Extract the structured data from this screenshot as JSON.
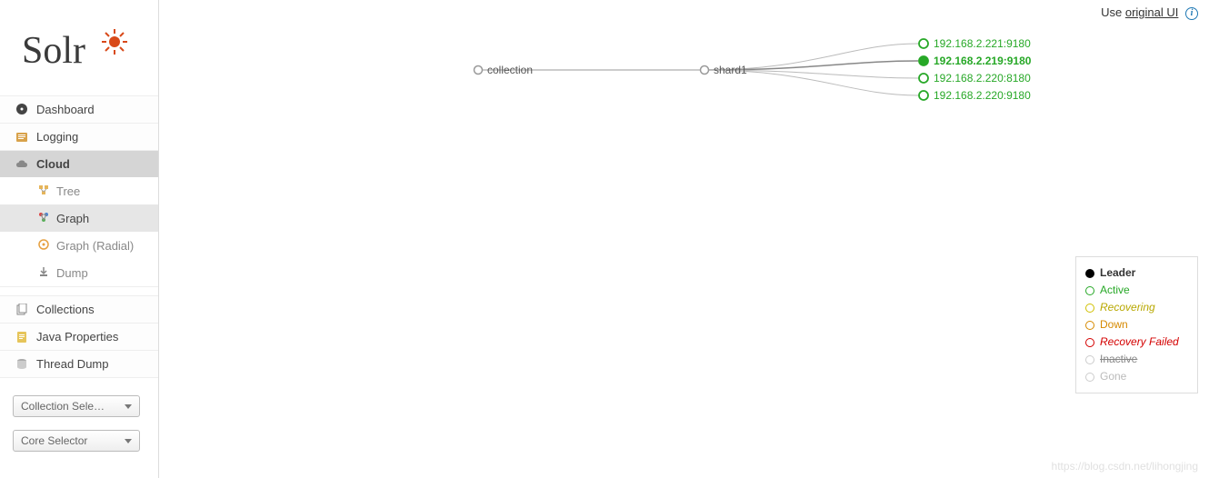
{
  "top_right": {
    "prefix": "Use ",
    "link": "original UI"
  },
  "sidebar": {
    "items": [
      {
        "label": "Dashboard"
      },
      {
        "label": "Logging"
      },
      {
        "label": "Cloud"
      },
      {
        "label": "Collections"
      },
      {
        "label": "Java Properties"
      },
      {
        "label": "Thread Dump"
      }
    ],
    "cloud_sub": [
      {
        "label": "Tree"
      },
      {
        "label": "Graph"
      },
      {
        "label": "Graph (Radial)"
      },
      {
        "label": "Dump"
      }
    ],
    "collection_selector": "Collection Sele…",
    "core_selector": "Core Selector"
  },
  "graph": {
    "collection_label": "collection",
    "shard_label": "shard1",
    "replicas": [
      {
        "host": "192.168.2.221:9180",
        "state": "active"
      },
      {
        "host": "192.168.2.219:9180",
        "state": "leader"
      },
      {
        "host": "192.168.2.220:8180",
        "state": "active"
      },
      {
        "host": "192.168.2.220:9180",
        "state": "active"
      }
    ]
  },
  "legend": {
    "leader": "Leader",
    "active": "Active",
    "recovering": "Recovering",
    "down": "Down",
    "recovery_failed": "Recovery Failed",
    "inactive": "Inactive",
    "gone": "Gone"
  },
  "watermark": "https://blog.csdn.net/lihongjing"
}
